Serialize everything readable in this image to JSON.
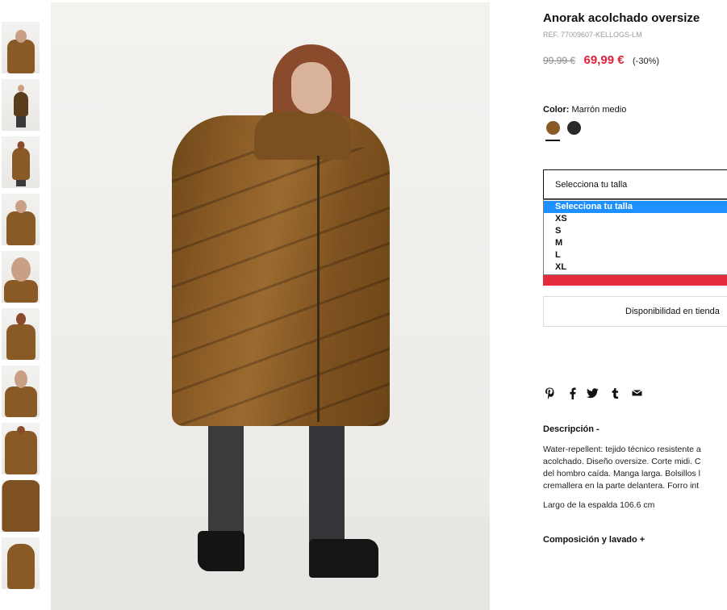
{
  "product": {
    "title": "Anorak acolchado oversize",
    "ref": "REF. 77009607-KELLOGS-LM",
    "old_price": "99,99 €",
    "new_price": "69,99 €",
    "discount": "(-30%)",
    "price_color": "#e0213a"
  },
  "color": {
    "label": "Color:",
    "value": "Marrón medio",
    "swatches": [
      {
        "name": "brown",
        "hex": "#8a5a26",
        "selected": true
      },
      {
        "name": "black",
        "hex": "#2a2a2a",
        "selected": false
      }
    ]
  },
  "size": {
    "select_label": "Selecciona tu talla",
    "options": [
      "Selecciona tu talla",
      "XS",
      "S",
      "M",
      "L",
      "XL"
    ],
    "highlighted": "Selecciona tu talla"
  },
  "availability_label": "Disponibilidad en tienda",
  "share_icons": [
    "pinterest-icon",
    "facebook-icon",
    "twitter-icon",
    "tumblr-icon",
    "email-icon"
  ],
  "share_glyphs": {
    "pinterest": "P",
    "facebook": "f",
    "twitter": "t",
    "tumblr": "t",
    "email": "✉"
  },
  "description": {
    "title": "Descripción -",
    "lines": [
      "Water-repellent: tejido técnico resistente a",
      "acolchado. Diseño oversize. Corte midi. C",
      "del hombro caída. Manga larga. Bolsillos l",
      "cremallera en la parte delantera. Forro int"
    ],
    "length": "Largo de la espalda 106.6 cm"
  },
  "composition_title": "Composición y lavado +",
  "gallery": {
    "thumbnail_count": 10
  }
}
